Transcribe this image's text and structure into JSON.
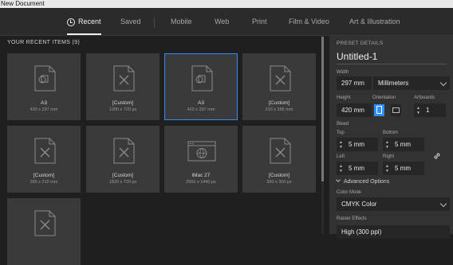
{
  "window": {
    "title": "New Document"
  },
  "tabs": [
    {
      "label": "Recent"
    },
    {
      "label": "Saved"
    },
    {
      "label": "Mobile"
    },
    {
      "label": "Web"
    },
    {
      "label": "Print"
    },
    {
      "label": "Film & Video"
    },
    {
      "label": "Art & Illustration"
    }
  ],
  "recent": {
    "heading": "YOUR RECENT ITEMS",
    "count": "(9)",
    "items": [
      {
        "name": "A3",
        "size": "420 x 297 mm",
        "icon": "document-shapes-icon"
      },
      {
        "name": "[Custom]",
        "size": "1280 x 720 px",
        "icon": "document-custom-icon"
      },
      {
        "name": "A3",
        "size": "420 x 297 mm",
        "icon": "document-shapes-icon"
      },
      {
        "name": "[Custom]",
        "size": "210 x 285 mm",
        "icon": "document-custom-icon"
      },
      {
        "name": "[Custom]",
        "size": "285 x 210 mm",
        "icon": "document-custom-icon"
      },
      {
        "name": "[Custom]",
        "size": "1820 x 720 px",
        "icon": "document-custom-icon"
      },
      {
        "name": "iMac 27",
        "size": "2560 x 1440 px",
        "icon": "web-window-icon"
      },
      {
        "name": "[Custom]",
        "size": "300 x 300 px",
        "icon": "document-custom-icon"
      },
      {
        "name": "",
        "size": "",
        "icon": "document-custom-icon"
      }
    ]
  },
  "preset": {
    "heading": "PRESET DETAILS",
    "name": "Untitled-1",
    "width_label": "Width",
    "width_value": "297 mm",
    "units_value": "Millimeters",
    "height_label": "Height",
    "height_value": "420 mm",
    "orientation_label": "Orientation",
    "artboards_label": "Artboards",
    "artboards_value": "1",
    "bleed_label": "Bleed",
    "top_label": "Top",
    "top_value": "5 mm",
    "bottom_label": "Bottom",
    "bottom_value": "5 mm",
    "left_label": "Left",
    "left_value": "5 mm",
    "right_label": "Right",
    "right_value": "5 mm",
    "advanced_label": "Advanced Options",
    "color_mode_label": "Color Mode",
    "color_mode_value": "CMYK Color",
    "raster_label": "Raster Effects",
    "raster_value": "High (300 ppi)"
  },
  "colors": {
    "accent": "#2e8fff",
    "panel": "#323232",
    "background": "#1f1f1f"
  }
}
